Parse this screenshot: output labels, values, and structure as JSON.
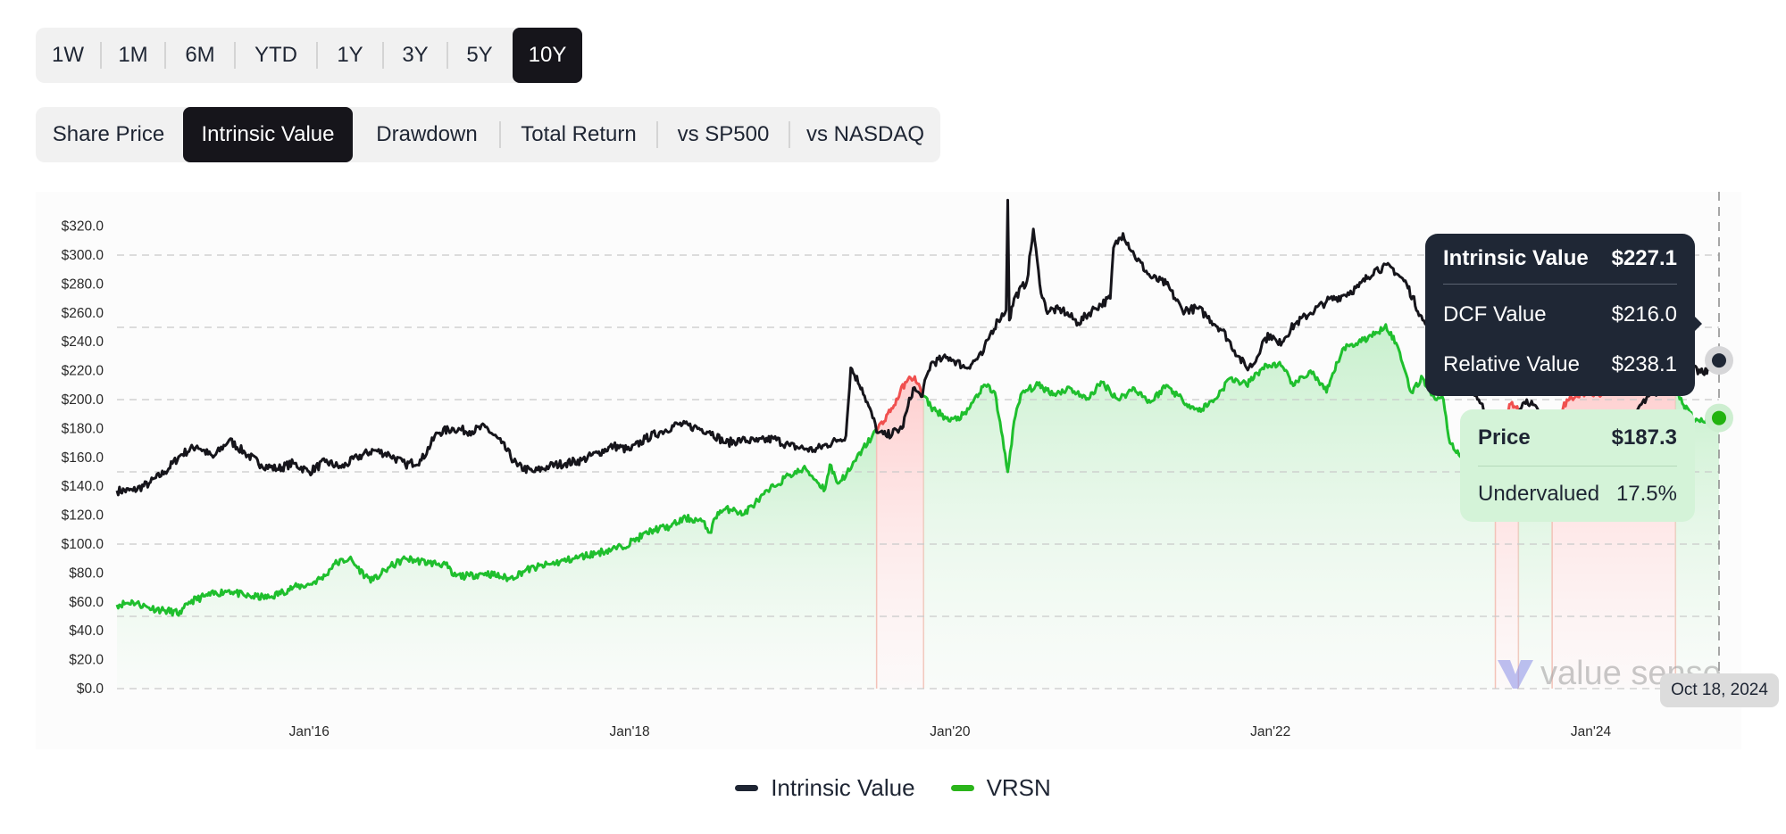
{
  "range_selector": {
    "options": [
      "1W",
      "1M",
      "6M",
      "YTD",
      "1Y",
      "3Y",
      "5Y",
      "10Y"
    ],
    "active": "10Y"
  },
  "view_tabs": {
    "options": [
      "Share Price",
      "Intrinsic Value",
      "Drawdown",
      "Total Return",
      "vs SP500",
      "vs NASDAQ"
    ],
    "active": "Intrinsic Value"
  },
  "colors": {
    "intrinsic": "#16151b",
    "price": "#1fbf2d",
    "overvalued": "#f0504f",
    "undervalued_fill": "#d4f3d8",
    "overvalued_fill": "#ffd6d6",
    "tooltip_dark": "#1f2735"
  },
  "tooltip": {
    "intrinsic_label": "Intrinsic Value",
    "intrinsic_value": "$227.1",
    "dcf_label": "DCF Value",
    "dcf_value": "$216.0",
    "relative_label": "Relative Value",
    "relative_value": "$238.1",
    "price_label": "Price",
    "price_value": "$187.3",
    "valuation_label": "Undervalued",
    "valuation_value": "17.5%"
  },
  "cursor_date": "Oct 18, 2024",
  "watermark": "value sense",
  "legend": [
    {
      "label": "Intrinsic Value",
      "color": "#1e2533"
    },
    {
      "label": "VRSN",
      "color": "#2bb51b"
    }
  ],
  "chart_data": {
    "type": "line",
    "title": "",
    "xlabel": "",
    "ylabel": "",
    "ylim": [
      0,
      320
    ],
    "xlim": [
      2014.8,
      2024.8
    ],
    "y_ticks": [
      "$0.0",
      "$20.0",
      "$40.0",
      "$60.0",
      "$80.0",
      "$100.0",
      "$120.0",
      "$140.0",
      "$160.0",
      "$180.0",
      "$200.0",
      "$220.0",
      "$240.0",
      "$260.0",
      "$280.0",
      "$300.0",
      "$320.0"
    ],
    "y_tick_values": [
      0,
      20,
      40,
      60,
      80,
      100,
      120,
      140,
      160,
      180,
      200,
      220,
      240,
      260,
      280,
      300,
      320
    ],
    "gridlines": [
      0,
      50,
      100,
      150,
      200,
      250,
      300
    ],
    "x_ticks": [
      {
        "label": "Jan'16",
        "x": 2016.0
      },
      {
        "label": "Jan'18",
        "x": 2018.0
      },
      {
        "label": "Jan'20",
        "x": 2020.0
      },
      {
        "label": "Jan'22",
        "x": 2022.0
      },
      {
        "label": "Jan'24",
        "x": 2024.0
      }
    ],
    "legend_position": "bottom",
    "series": [
      {
        "name": "Intrinsic Value",
        "points": [
          [
            2014.8,
            137
          ],
          [
            2014.9,
            137
          ],
          [
            2015.0,
            142
          ],
          [
            2015.1,
            150
          ],
          [
            2015.2,
            162
          ],
          [
            2015.3,
            168
          ],
          [
            2015.4,
            160
          ],
          [
            2015.5,
            172
          ],
          [
            2015.6,
            163
          ],
          [
            2015.7,
            155
          ],
          [
            2015.8,
            152
          ],
          [
            2015.9,
            156
          ],
          [
            2016.0,
            150
          ],
          [
            2016.1,
            157
          ],
          [
            2016.2,
            153
          ],
          [
            2016.3,
            160
          ],
          [
            2016.4,
            165
          ],
          [
            2016.5,
            162
          ],
          [
            2016.6,
            155
          ],
          [
            2016.7,
            158
          ],
          [
            2016.8,
            177
          ],
          [
            2016.9,
            180
          ],
          [
            2017.0,
            178
          ],
          [
            2017.1,
            181
          ],
          [
            2017.2,
            170
          ],
          [
            2017.3,
            154
          ],
          [
            2017.4,
            150
          ],
          [
            2017.5,
            154
          ],
          [
            2017.6,
            156
          ],
          [
            2017.7,
            158
          ],
          [
            2017.8,
            163
          ],
          [
            2017.9,
            168
          ],
          [
            2018.0,
            165
          ],
          [
            2018.1,
            173
          ],
          [
            2018.2,
            178
          ],
          [
            2018.3,
            183
          ],
          [
            2018.4,
            181
          ],
          [
            2018.5,
            178
          ],
          [
            2018.6,
            170
          ],
          [
            2018.7,
            172
          ],
          [
            2018.8,
            171
          ],
          [
            2018.9,
            173
          ],
          [
            2019.0,
            168
          ],
          [
            2019.1,
            166
          ],
          [
            2019.15,
            165
          ],
          [
            2019.3,
            172
          ],
          [
            2019.35,
            175
          ],
          [
            2019.38,
            222
          ],
          [
            2019.45,
            208
          ],
          [
            2019.55,
            177
          ],
          [
            2019.6,
            175
          ],
          [
            2019.7,
            180
          ],
          [
            2019.73,
            192
          ],
          [
            2019.77,
            208
          ],
          [
            2019.82,
            202
          ],
          [
            2019.88,
            225
          ],
          [
            2019.95,
            228
          ],
          [
            2020.0,
            229
          ],
          [
            2020.1,
            222
          ],
          [
            2020.2,
            231
          ],
          [
            2020.25,
            245
          ],
          [
            2020.3,
            255
          ],
          [
            2020.35,
            262
          ],
          [
            2020.36,
            338
          ],
          [
            2020.37,
            255
          ],
          [
            2020.4,
            270
          ],
          [
            2020.48,
            282
          ],
          [
            2020.52,
            318
          ],
          [
            2020.56,
            280
          ],
          [
            2020.6,
            262
          ],
          [
            2020.7,
            262
          ],
          [
            2020.8,
            253
          ],
          [
            2020.9,
            263
          ],
          [
            2021.0,
            270
          ],
          [
            2021.02,
            305
          ],
          [
            2021.08,
            315
          ],
          [
            2021.15,
            300
          ],
          [
            2021.25,
            285
          ],
          [
            2021.35,
            280
          ],
          [
            2021.45,
            262
          ],
          [
            2021.55,
            263
          ],
          [
            2021.6,
            258
          ],
          [
            2021.7,
            248
          ],
          [
            2021.8,
            230
          ],
          [
            2021.85,
            222
          ],
          [
            2021.9,
            225
          ],
          [
            2021.95,
            240
          ],
          [
            2022.0,
            245
          ],
          [
            2022.05,
            238
          ],
          [
            2022.15,
            252
          ],
          [
            2022.25,
            260
          ],
          [
            2022.35,
            268
          ],
          [
            2022.45,
            272
          ],
          [
            2022.55,
            278
          ],
          [
            2022.65,
            290
          ],
          [
            2022.75,
            292
          ],
          [
            2022.85,
            280
          ],
          [
            2022.95,
            255
          ],
          [
            2023.05,
            242
          ],
          [
            2023.15,
            215
          ],
          [
            2023.25,
            210
          ],
          [
            2023.3,
            200
          ],
          [
            2023.4,
            178
          ],
          [
            2023.45,
            175
          ],
          [
            2023.5,
            180
          ],
          [
            2023.55,
            192
          ],
          [
            2023.6,
            200
          ],
          [
            2023.7,
            188
          ],
          [
            2023.78,
            170
          ],
          [
            2023.85,
            163
          ],
          [
            2023.95,
            172
          ],
          [
            2024.05,
            178
          ],
          [
            2024.15,
            185
          ],
          [
            2024.25,
            182
          ],
          [
            2024.3,
            195
          ],
          [
            2024.4,
            205
          ],
          [
            2024.5,
            208
          ],
          [
            2024.55,
            215
          ],
          [
            2024.62,
            222
          ],
          [
            2024.7,
            218
          ],
          [
            2024.78,
            225
          ],
          [
            2024.8,
            227.1
          ]
        ]
      },
      {
        "name": "VRSN",
        "points": [
          [
            2014.8,
            58
          ],
          [
            2014.9,
            60
          ],
          [
            2015.0,
            56
          ],
          [
            2015.1,
            54
          ],
          [
            2015.2,
            52
          ],
          [
            2015.25,
            60
          ],
          [
            2015.35,
            64
          ],
          [
            2015.5,
            68
          ],
          [
            2015.6,
            64
          ],
          [
            2015.75,
            63
          ],
          [
            2015.9,
            70
          ],
          [
            2016.0,
            72
          ],
          [
            2016.1,
            78
          ],
          [
            2016.15,
            86
          ],
          [
            2016.25,
            90
          ],
          [
            2016.35,
            78
          ],
          [
            2016.4,
            75
          ],
          [
            2016.5,
            84
          ],
          [
            2016.6,
            90
          ],
          [
            2016.75,
            87
          ],
          [
            2016.85,
            86
          ],
          [
            2016.9,
            78
          ],
          [
            2017.0,
            78
          ],
          [
            2017.1,
            80
          ],
          [
            2017.25,
            76
          ],
          [
            2017.35,
            82
          ],
          [
            2017.5,
            86
          ],
          [
            2017.65,
            90
          ],
          [
            2017.8,
            94
          ],
          [
            2017.95,
            98
          ],
          [
            2018.05,
            104
          ],
          [
            2018.15,
            110
          ],
          [
            2018.25,
            112
          ],
          [
            2018.35,
            118
          ],
          [
            2018.45,
            116
          ],
          [
            2018.5,
            108
          ],
          [
            2018.55,
            122
          ],
          [
            2018.65,
            125
          ],
          [
            2018.7,
            120
          ],
          [
            2018.8,
            130
          ],
          [
            2018.9,
            140
          ],
          [
            2019.0,
            148
          ],
          [
            2019.1,
            152
          ],
          [
            2019.18,
            142
          ],
          [
            2019.22,
            138
          ],
          [
            2019.25,
            155
          ],
          [
            2019.3,
            142
          ],
          [
            2019.38,
            152
          ],
          [
            2019.45,
            165
          ],
          [
            2019.55,
            180
          ],
          [
            2019.65,
            196
          ],
          [
            2019.72,
            212
          ],
          [
            2019.78,
            216
          ],
          [
            2019.82,
            205
          ],
          [
            2019.88,
            195
          ],
          [
            2019.92,
            192
          ],
          [
            2020.0,
            185
          ],
          [
            2020.1,
            190
          ],
          [
            2020.15,
            200
          ],
          [
            2020.22,
            210
          ],
          [
            2020.28,
            205
          ],
          [
            2020.32,
            178
          ],
          [
            2020.36,
            150
          ],
          [
            2020.4,
            185
          ],
          [
            2020.45,
            205
          ],
          [
            2020.55,
            210
          ],
          [
            2020.65,
            204
          ],
          [
            2020.75,
            208
          ],
          [
            2020.85,
            200
          ],
          [
            2020.95,
            212
          ],
          [
            2021.05,
            200
          ],
          [
            2021.15,
            208
          ],
          [
            2021.25,
            198
          ],
          [
            2021.35,
            210
          ],
          [
            2021.45,
            200
          ],
          [
            2021.55,
            192
          ],
          [
            2021.65,
            200
          ],
          [
            2021.75,
            215
          ],
          [
            2021.85,
            210
          ],
          [
            2021.95,
            222
          ],
          [
            2022.05,
            225
          ],
          [
            2022.15,
            210
          ],
          [
            2022.25,
            220
          ],
          [
            2022.35,
            205
          ],
          [
            2022.45,
            235
          ],
          [
            2022.55,
            240
          ],
          [
            2022.65,
            245
          ],
          [
            2022.72,
            252
          ],
          [
            2022.8,
            235
          ],
          [
            2022.88,
            205
          ],
          [
            2022.95,
            215
          ],
          [
            2023.02,
            202
          ],
          [
            2023.08,
            200
          ],
          [
            2023.12,
            170
          ],
          [
            2023.2,
            160
          ],
          [
            2023.28,
            163
          ],
          [
            2023.35,
            170
          ],
          [
            2023.45,
            185
          ],
          [
            2023.5,
            197
          ],
          [
            2023.58,
            190
          ],
          [
            2023.65,
            180
          ],
          [
            2023.75,
            175
          ],
          [
            2023.85,
            200
          ],
          [
            2023.95,
            205
          ],
          [
            2024.05,
            203
          ],
          [
            2024.15,
            210
          ],
          [
            2024.25,
            205
          ],
          [
            2024.35,
            208
          ],
          [
            2024.45,
            214
          ],
          [
            2024.52,
            210
          ],
          [
            2024.58,
            196
          ],
          [
            2024.65,
            185
          ],
          [
            2024.72,
            186
          ],
          [
            2024.78,
            188
          ],
          [
            2024.8,
            187.3
          ]
        ]
      }
    ]
  }
}
